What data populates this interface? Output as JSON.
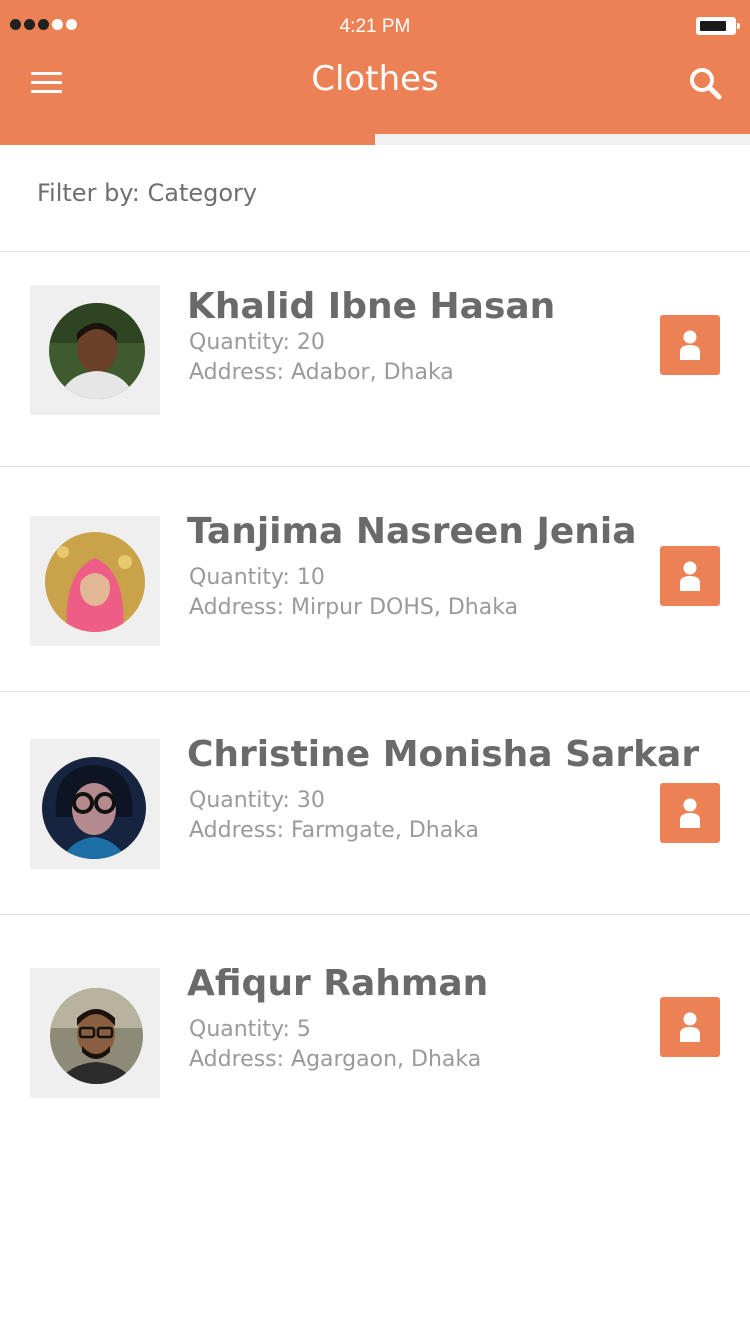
{
  "status_bar": {
    "time": "4:21 PM",
    "signal_bars": 5,
    "signal_filled": 3
  },
  "header": {
    "title": "Clothes",
    "menu_icon": "hamburger-menu-icon",
    "search_icon": "search-icon",
    "accent_color": "#ec8156"
  },
  "filter": {
    "label": "Filter by: Category"
  },
  "people": [
    {
      "name": "Khalid Ibne Hasan",
      "quantity": "Quantity: 20",
      "address": "Address: Adabor, Dhaka"
    },
    {
      "name": "Tanjima Nasreen Jenia",
      "quantity": "Quantity: 10",
      "address": "Address: Mirpur DOHS, Dhaka"
    },
    {
      "name": "Christine Monisha Sarkar",
      "quantity": "Quantity: 30",
      "address": "Address: Farmgate, Dhaka"
    },
    {
      "name": "Afiqur Rahman",
      "quantity": "Quantity: 5",
      "address": "Address: Agargaon, Dhaka"
    }
  ]
}
